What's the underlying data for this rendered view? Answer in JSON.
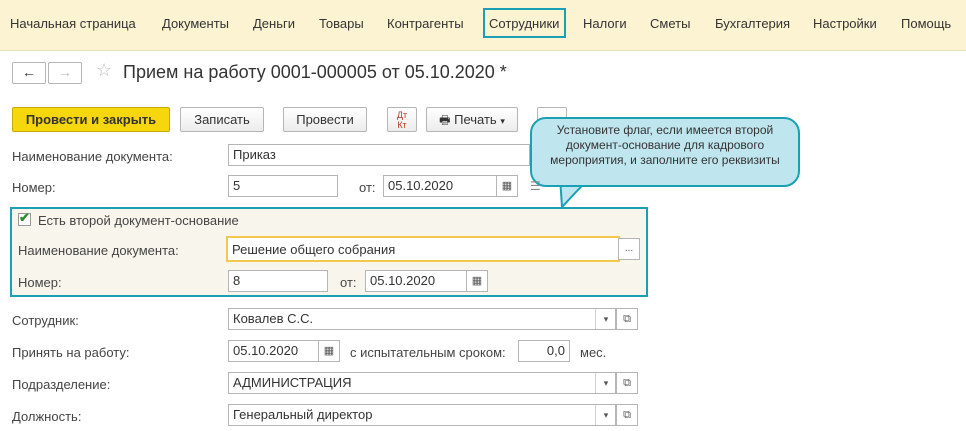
{
  "menu": {
    "items": [
      "Начальная страница",
      "Документы",
      "Деньги",
      "Товары",
      "Контрагенты",
      "Сотрудники",
      "Налоги",
      "Сметы",
      "Бухгалтерия",
      "Настройки",
      "Помощь"
    ],
    "active": "Сотрудники"
  },
  "nav": {
    "back": "←",
    "forward": "→"
  },
  "document": {
    "title": "Прием на работу 0001-000005 от 05.10.2020 *"
  },
  "toolbar": {
    "post_close": "Провести и закрыть",
    "save": "Записать",
    "post": "Провести",
    "dtkt_top": "Дт",
    "dtkt_bottom": "Кт",
    "print": "Печать"
  },
  "callout": {
    "text": "Установите флаг, если имеется второй документ-основание для кадрового мероприятия, и заполните его реквизиты"
  },
  "form": {
    "doc_name_label": "Наименование документа:",
    "doc_name_value": "Приказ",
    "number_label": "Номер:",
    "number_value": "5",
    "from_label": "от:",
    "date_value": "05.10.2020",
    "second_basis": {
      "checkbox_label": "Есть второй документ-основание",
      "checked": true,
      "doc_name_label": "Наименование документа:",
      "doc_name_value": "Решение общего собрания",
      "number_label": "Номер:",
      "number_value": "8",
      "from_label": "от:",
      "date_value": "05.10.2020"
    },
    "employee_label": "Сотрудник:",
    "employee_value": "Ковалев С.С.",
    "hire_label": "Принять на работу:",
    "hire_date": "05.10.2020",
    "probation_label": "с испытательным сроком:",
    "probation_value": "0,0",
    "probation_unit": "мес.",
    "department_label": "Подразделение:",
    "department_value": "АДМИНИСТРАЦИЯ",
    "position_label": "Должность:",
    "position_value": "Генеральный директор"
  },
  "icons": {
    "ellipsis": "...",
    "dropdown": "▾",
    "open": "⧉"
  },
  "colors": {
    "menu_bg": "#fbf3d1",
    "accent": "#1aa0b4",
    "primary_button": "#f6d60c",
    "highlight_field": "#f2c94c"
  }
}
